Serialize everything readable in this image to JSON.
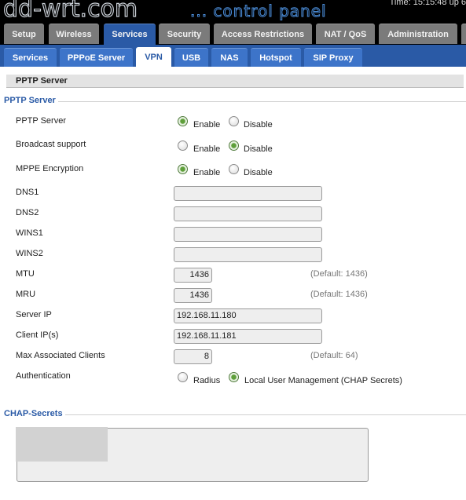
{
  "header": {
    "logo": "dd-wrt.com",
    "subtitle": "... control panel",
    "uptime": "Time: 15:15:48 up 6"
  },
  "main_tabs": [
    "Setup",
    "Wireless",
    "Services",
    "Security",
    "Access Restrictions",
    "NAT / QoS",
    "Administration"
  ],
  "main_tab_active": "Services",
  "sub_tabs": [
    "Services",
    "PPPoE Server",
    "VPN",
    "USB",
    "NAS",
    "Hotspot",
    "SIP Proxy"
  ],
  "sub_tab_active": "VPN",
  "page": {
    "section_title": "PPTP Server",
    "pptp_legend": "PPTP Server",
    "chap_legend": "CHAP-Secrets"
  },
  "form": {
    "pptp_server": {
      "label": "PPTP Server",
      "enable": "Enable",
      "disable": "Disable",
      "selected": "Enable"
    },
    "broadcast": {
      "label": "Broadcast support",
      "enable": "Enable",
      "disable": "Disable",
      "selected": "Disable"
    },
    "mppe": {
      "label": "MPPE Encryption",
      "enable": "Enable",
      "disable": "Disable",
      "selected": "Enable"
    },
    "dns1": {
      "label": "DNS1",
      "value": ""
    },
    "dns2": {
      "label": "DNS2",
      "value": ""
    },
    "wins1": {
      "label": "WINS1",
      "value": ""
    },
    "wins2": {
      "label": "WINS2",
      "value": ""
    },
    "mtu": {
      "label": "MTU",
      "value": "1436",
      "hint": "(Default: 1436)"
    },
    "mru": {
      "label": "MRU",
      "value": "1436",
      "hint": "(Default: 1436)"
    },
    "server_ip": {
      "label": "Server IP",
      "value": "192.168.11.180"
    },
    "client_ips": {
      "label": "Client IP(s)",
      "value": "192.168.11.181"
    },
    "max_clients": {
      "label": "Max Associated Clients",
      "value": "8",
      "hint": "(Default: 64)"
    },
    "auth": {
      "label": "Authentication",
      "radius": "Radius",
      "local": "Local User Management (CHAP Secrets)",
      "selected": "Local User Management (CHAP Secrets)"
    }
  }
}
